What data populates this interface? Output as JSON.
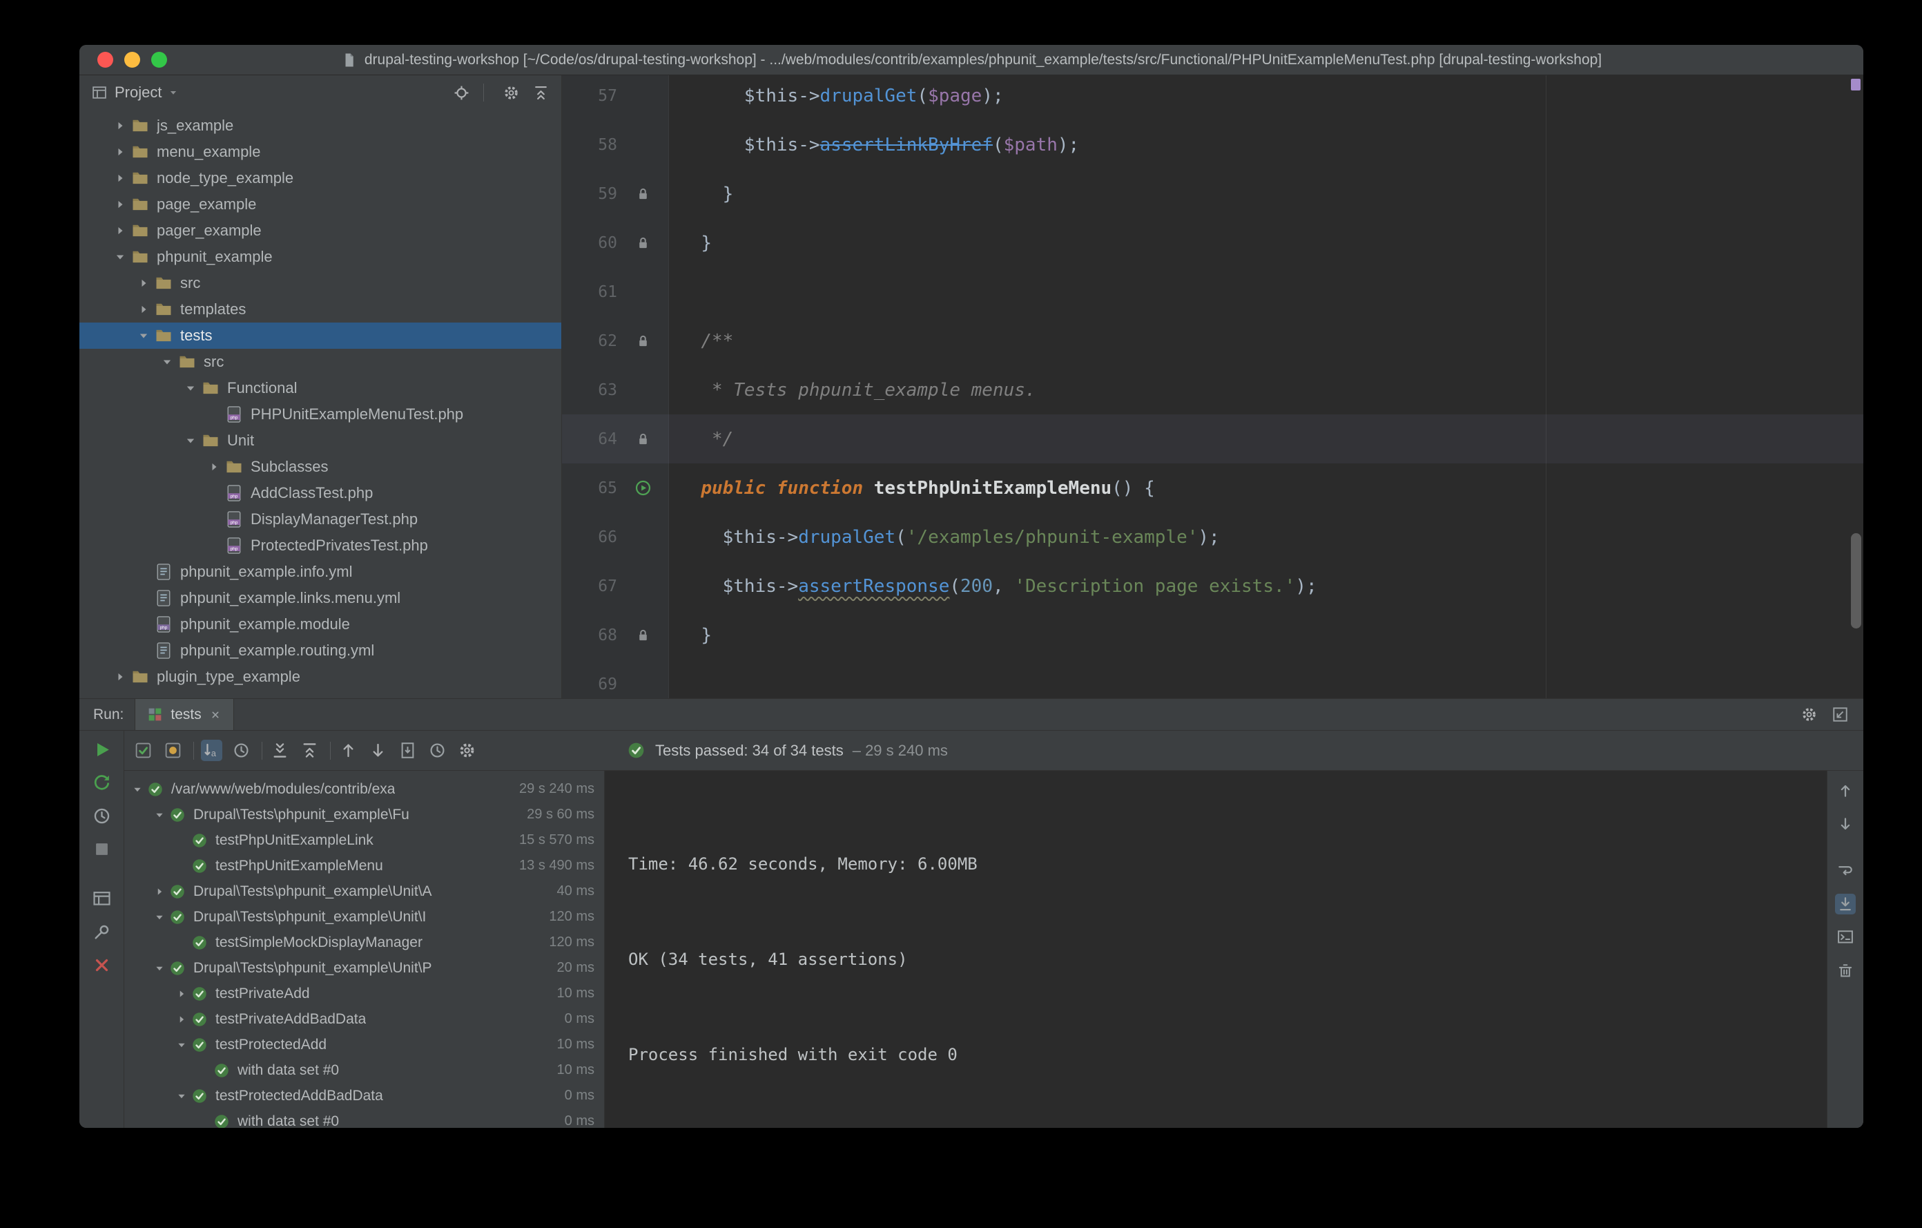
{
  "window": {
    "title": "drupal-testing-workshop [~/Code/os/drupal-testing-workshop] - .../web/modules/contrib/examples/phpunit_example/tests/src/Functional/PHPUnitExampleMenuTest.php [drupal-testing-workshop]"
  },
  "colors": {
    "selection_blue": "#2d5a87",
    "pass_green": "#499c54",
    "fail_red": "#c75450",
    "keyword_orange": "#cc7832",
    "string_green": "#6a8759",
    "method_blue": "#5394d6"
  },
  "project_panel": {
    "title": "Project",
    "header_icons": [
      "locate-file-icon",
      "sep",
      "settings-gear-icon",
      "collapse-all-icon"
    ],
    "tree": [
      {
        "label": "js_example",
        "depth": 1,
        "icon": "folder",
        "arrow": "collapsed"
      },
      {
        "label": "menu_example",
        "depth": 1,
        "icon": "folder",
        "arrow": "collapsed"
      },
      {
        "label": "node_type_example",
        "depth": 1,
        "icon": "folder",
        "arrow": "collapsed"
      },
      {
        "label": "page_example",
        "depth": 1,
        "icon": "folder",
        "arrow": "collapsed"
      },
      {
        "label": "pager_example",
        "depth": 1,
        "icon": "folder",
        "arrow": "collapsed"
      },
      {
        "label": "phpunit_example",
        "depth": 1,
        "icon": "folder",
        "arrow": "expanded"
      },
      {
        "label": "src",
        "depth": 2,
        "icon": "folder",
        "arrow": "collapsed"
      },
      {
        "label": "templates",
        "depth": 2,
        "icon": "folder",
        "arrow": "collapsed"
      },
      {
        "label": "tests",
        "depth": 2,
        "icon": "folder",
        "arrow": "expanded",
        "selected": true
      },
      {
        "label": "src",
        "depth": 3,
        "icon": "folder",
        "arrow": "expanded"
      },
      {
        "label": "Functional",
        "depth": 4,
        "icon": "folder",
        "arrow": "expanded"
      },
      {
        "label": "PHPUnitExampleMenuTest.php",
        "depth": 5,
        "icon": "php-test",
        "arrow": "none"
      },
      {
        "label": "Unit",
        "depth": 4,
        "icon": "folder",
        "arrow": "expanded"
      },
      {
        "label": "Subclasses",
        "depth": 5,
        "icon": "folder",
        "arrow": "collapsed"
      },
      {
        "label": "AddClassTest.php",
        "depth": 5,
        "icon": "php-test",
        "arrow": "none"
      },
      {
        "label": "DisplayManagerTest.php",
        "depth": 5,
        "icon": "php-test",
        "arrow": "none"
      },
      {
        "label": "ProtectedPrivatesTest.php",
        "depth": 5,
        "icon": "php-test",
        "arrow": "none"
      },
      {
        "label": "phpunit_example.info.yml",
        "depth": 2,
        "icon": "yml",
        "arrow": "none"
      },
      {
        "label": "phpunit_example.links.menu.yml",
        "depth": 2,
        "icon": "yml",
        "arrow": "none"
      },
      {
        "label": "phpunit_example.module",
        "depth": 2,
        "icon": "php-file",
        "arrow": "none"
      },
      {
        "label": "phpunit_example.routing.yml",
        "depth": 2,
        "icon": "yml",
        "arrow": "none"
      },
      {
        "label": "plugin_type_example",
        "depth": 1,
        "icon": "folder",
        "arrow": "collapsed"
      }
    ]
  },
  "editor": {
    "lines": [
      {
        "num": "57",
        "gutter": "",
        "segments": [
          {
            "t": "      ",
            "c": ""
          },
          {
            "t": "$this",
            "c": ""
          },
          {
            "t": "->",
            "c": ""
          },
          {
            "t": "drupalGet",
            "c": "t-fn"
          },
          {
            "t": "(",
            "c": ""
          },
          {
            "t": "$page",
            "c": "t-var"
          },
          {
            "t": ");",
            "c": ""
          }
        ]
      },
      {
        "num": "58",
        "gutter": "",
        "segments": [
          {
            "t": "      ",
            "c": ""
          },
          {
            "t": "$this",
            "c": ""
          },
          {
            "t": "->",
            "c": ""
          },
          {
            "t": "assertLinkByHref",
            "c": "t-fn t-dep"
          },
          {
            "t": "(",
            "c": ""
          },
          {
            "t": "$path",
            "c": "t-var"
          },
          {
            "t": ");",
            "c": ""
          }
        ]
      },
      {
        "num": "59",
        "gutter": "fold",
        "segments": [
          {
            "t": "    ",
            "c": ""
          },
          {
            "t": "}",
            "c": ""
          }
        ]
      },
      {
        "num": "60",
        "gutter": "fold",
        "segments": [
          {
            "t": "  ",
            "c": ""
          },
          {
            "t": "}",
            "c": ""
          }
        ]
      },
      {
        "num": "61",
        "gutter": "",
        "segments": []
      },
      {
        "num": "62",
        "gutter": "fold",
        "segments": [
          {
            "t": "  ",
            "c": ""
          },
          {
            "t": "/**",
            "c": "t-cmt"
          }
        ]
      },
      {
        "num": "63",
        "gutter": "",
        "segments": [
          {
            "t": "   ",
            "c": ""
          },
          {
            "t": "* Tests phpunit_example menus.",
            "c": "t-cmt"
          }
        ]
      },
      {
        "num": "64",
        "gutter": "fold",
        "caret": true,
        "segments": [
          {
            "t": "   ",
            "c": ""
          },
          {
            "t": "*/",
            "c": "t-cmt"
          }
        ]
      },
      {
        "num": "65",
        "gutter": "run",
        "segments": [
          {
            "t": "  ",
            "c": ""
          },
          {
            "t": "public function",
            "c": "t-kw"
          },
          {
            "t": " ",
            "c": ""
          },
          {
            "t": "testPhpUnitExampleMenu",
            "c": "t-mn"
          },
          {
            "t": "() {",
            "c": ""
          }
        ]
      },
      {
        "num": "66",
        "gutter": "",
        "segments": [
          {
            "t": "    ",
            "c": ""
          },
          {
            "t": "$this",
            "c": ""
          },
          {
            "t": "->",
            "c": ""
          },
          {
            "t": "drupalGet",
            "c": "t-fn"
          },
          {
            "t": "(",
            "c": ""
          },
          {
            "t": "'/examples/phpunit-example'",
            "c": "t-str"
          },
          {
            "t": ");",
            "c": ""
          }
        ]
      },
      {
        "num": "67",
        "gutter": "",
        "segments": [
          {
            "t": "    ",
            "c": ""
          },
          {
            "t": "$this",
            "c": ""
          },
          {
            "t": "->",
            "c": ""
          },
          {
            "t": "assertResponse",
            "c": "t-fn t-warn"
          },
          {
            "t": "(",
            "c": ""
          },
          {
            "t": "200",
            "c": "t-num"
          },
          {
            "t": ", ",
            "c": ""
          },
          {
            "t": "'Description page exists.'",
            "c": "t-str"
          },
          {
            "t": ");",
            "c": ""
          }
        ]
      },
      {
        "num": "68",
        "gutter": "fold",
        "segments": [
          {
            "t": "  ",
            "c": ""
          },
          {
            "t": "}",
            "c": ""
          }
        ]
      },
      {
        "num": "69",
        "gutter": "",
        "segments": []
      }
    ]
  },
  "run_panel": {
    "label": "Run:",
    "tab": {
      "label": "tests"
    },
    "tabbar_icons": [
      "run-settings-gear-icon",
      "hide-window-icon"
    ],
    "left_icons": [
      "run-icon",
      "rerun-failed-icon",
      "auto-test-icon",
      "stop-icon",
      "restore-layout-icon",
      "pin-tab-icon",
      "close-icon"
    ],
    "toolbar_icons": [
      "show-passed-icon",
      "show-ignored-icon",
      "sep",
      {
        "name": "sort-alphabetically-icon",
        "active": true
      },
      "sort-by-duration-icon",
      "sep",
      "expand-all-icon",
      "collapse-all-icon",
      "sep",
      "previous-failed-icon",
      "next-failed-icon",
      "import-results-icon",
      "test-history-icon",
      "run-options-gear-icon"
    ],
    "right_icons": [
      "scroll-up-icon",
      "scroll-down-icon",
      "soft-wrap-icon",
      {
        "name": "scroll-to-end-icon",
        "active": true
      },
      "console-settings-icon",
      "clear-all-icon"
    ],
    "status": {
      "text": "Tests passed: 34 of 34 tests",
      "duration": "– 29 s 240 ms"
    },
    "test_tree": [
      {
        "label": "/var/www/web/modules/contrib/exa",
        "time": "29 s 240 ms",
        "depth": 0,
        "arrow": "expanded"
      },
      {
        "label": "Drupal\\Tests\\phpunit_example\\Fu",
        "time": "29 s 60 ms",
        "depth": 1,
        "arrow": "expanded"
      },
      {
        "label": "testPhpUnitExampleLink",
        "time": "15 s 570 ms",
        "depth": 2,
        "arrow": "none"
      },
      {
        "label": "testPhpUnitExampleMenu",
        "time": "13 s 490 ms",
        "depth": 2,
        "arrow": "none"
      },
      {
        "label": "Drupal\\Tests\\phpunit_example\\Unit\\A",
        "time": "40 ms",
        "depth": 1,
        "arrow": "collapsed"
      },
      {
        "label": "Drupal\\Tests\\phpunit_example\\Unit\\I",
        "time": "120 ms",
        "depth": 1,
        "arrow": "expanded"
      },
      {
        "label": "testSimpleMockDisplayManager",
        "time": "120 ms",
        "depth": 2,
        "arrow": "none"
      },
      {
        "label": "Drupal\\Tests\\phpunit_example\\Unit\\P",
        "time": "20 ms",
        "depth": 1,
        "arrow": "expanded"
      },
      {
        "label": "testPrivateAdd",
        "time": "10 ms",
        "depth": 2,
        "arrow": "collapsed"
      },
      {
        "label": "testPrivateAddBadData",
        "time": "0 ms",
        "depth": 2,
        "arrow": "collapsed"
      },
      {
        "label": "testProtectedAdd",
        "time": "10 ms",
        "depth": 2,
        "arrow": "expanded"
      },
      {
        "label": "with data set #0",
        "time": "10 ms",
        "depth": 3,
        "arrow": "none"
      },
      {
        "label": "testProtectedAddBadData",
        "time": "0 ms",
        "depth": 2,
        "arrow": "expanded"
      },
      {
        "label": "with data set #0",
        "time": "0 ms",
        "depth": 3,
        "arrow": "none"
      }
    ],
    "console_lines": [
      "Time: 46.62 seconds, Memory: 6.00MB",
      "OK (34 tests, 41 assertions)",
      "Process finished with exit code 0"
    ]
  }
}
